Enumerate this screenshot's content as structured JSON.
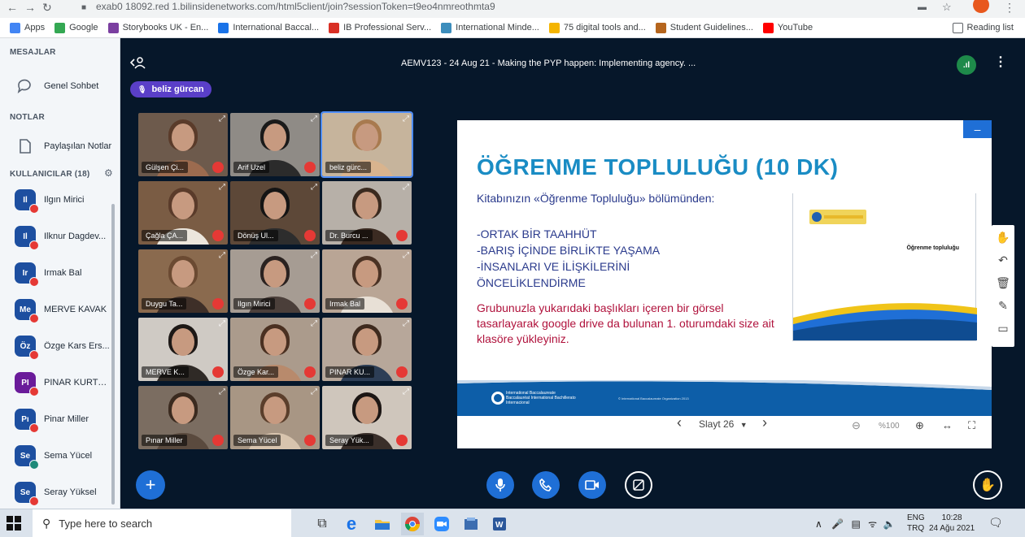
{
  "browser": {
    "url": "exab0 18092.red 1.bilinsidenetworks.com/html5client/join?sessionToken=t9eo4nmreothmta9",
    "bookmarks": [
      {
        "label": "Apps",
        "icon": "apps-icon",
        "color": "#4285f4"
      },
      {
        "label": "Google",
        "icon": "google-icon",
        "color": "#34a853"
      },
      {
        "label": "Storybooks UK - En...",
        "icon": "storybooks-icon",
        "color": "#7b3fa0"
      },
      {
        "label": "International Baccal...",
        "icon": "ib-icon",
        "color": "#1a73e8"
      },
      {
        "label": "IB Professional Serv...",
        "icon": "ib-pro-icon",
        "color": "#d93025"
      },
      {
        "label": "International Minde...",
        "icon": "minde-icon",
        "color": "#3c8dbc"
      },
      {
        "label": "75 digital tools and...",
        "icon": "tools-icon",
        "color": "#f4b400"
      },
      {
        "label": "Student Guidelines...",
        "icon": "guidelines-icon",
        "color": "#b5651d"
      },
      {
        "label": "YouTube",
        "icon": "youtube-icon",
        "color": "#ff0000"
      }
    ],
    "reading_list": "Reading list"
  },
  "sidebar": {
    "messages_title": "MESAJLAR",
    "public_chat": "Genel Sohbet",
    "notes_title": "NOTLAR",
    "shared_notes": "Paylaşılan Notlar",
    "users_title": "KULLANICILAR (18)",
    "users": [
      {
        "initials": "Il",
        "name": "Ilgın Mirici",
        "style": "blue",
        "mic": "red"
      },
      {
        "initials": "Il",
        "name": "Ilknur Dagdev...",
        "style": "blue",
        "mic": "red"
      },
      {
        "initials": "Ir",
        "name": "Irmak Bal",
        "style": "blue",
        "mic": "red"
      },
      {
        "initials": "Me",
        "name": "MERVE KAVAK",
        "style": "blue",
        "mic": "red"
      },
      {
        "initials": "Öz",
        "name": "Özge Kars Ers...",
        "style": "blue",
        "mic": "red"
      },
      {
        "initials": "PI",
        "name": "PINAR KURTO...",
        "style": "pink",
        "mic": "red"
      },
      {
        "initials": "Pı",
        "name": "Pinar Miller",
        "style": "blue",
        "mic": "red"
      },
      {
        "initials": "Se",
        "name": "Sema Yücel",
        "style": "blue",
        "mic": "green"
      },
      {
        "initials": "Se",
        "name": "Seray Yüksel",
        "style": "blue",
        "mic": "red"
      }
    ]
  },
  "header": {
    "back_icon": "back-users-icon",
    "title": "AEMV123 - 24 Aug 21 - Making the PYP happen: Implementing agency. ...",
    "connection": ".ıl",
    "talking": "beliz gürcan"
  },
  "videos": [
    {
      "name": "Gülşen Çi...",
      "shirt": "#9c6b4f",
      "hair": "#5a3b2a",
      "bg": "#6d5a4c",
      "active": false
    },
    {
      "name": "Arif Uzel",
      "shirt": "#2b2b2b",
      "hair": "#1a1a1a",
      "bg": "#8f8b86",
      "active": false
    },
    {
      "name": "beliz gürc...",
      "shirt": "#d9b48e",
      "hair": "#a87a4f",
      "bg": "#c6b49c",
      "active": true
    },
    {
      "name": "Çağla ÇA...",
      "shirt": "#ece6dc",
      "hair": "#5a3b2a",
      "bg": "#7a5c44",
      "active": false
    },
    {
      "name": "Dönüş Ul...",
      "shirt": "#2d2d2d",
      "hair": "#141414",
      "bg": "#5d4838",
      "active": false
    },
    {
      "name": "Dr. Burcu ...",
      "shirt": "#3b2b22",
      "hair": "#3a2a1f",
      "bg": "#b7b0a8",
      "active": false
    },
    {
      "name": "Duygu Ta...",
      "shirt": "#3e2f28",
      "hair": "#6b4a32",
      "bg": "#8a6a4e",
      "active": false
    },
    {
      "name": "Ilgın Mirici",
      "shirt": "#4b3f3a",
      "hair": "#2a2220",
      "bg": "#a69c93",
      "active": false
    },
    {
      "name": "Irmak Bal",
      "shirt": "#e8e0d6",
      "hair": "#4a3224",
      "bg": "#b9a595",
      "active": false
    },
    {
      "name": "MERVE K...",
      "shirt": "#2f2a26",
      "hair": "#1d1816",
      "bg": "#cfcac4",
      "active": false
    },
    {
      "name": "Özge Kar...",
      "shirt": "#b88a6c",
      "hair": "#4a3021",
      "bg": "#ab9b8c",
      "active": false
    },
    {
      "name": "PINAR KU...",
      "shirt": "#2d3e56",
      "hair": "#3e2a1e",
      "bg": "#b7a79a",
      "active": false
    },
    {
      "name": "Pınar Miller",
      "shirt": "#5a4a3e",
      "hair": "#3a2a1f",
      "bg": "#7b6d61",
      "active": false
    },
    {
      "name": "Sema Yücel",
      "shirt": "#d8c4ae",
      "hair": "#5b3e2b",
      "bg": "#a89684",
      "active": false
    },
    {
      "name": "Seray Yük...",
      "shirt": "#3a2f2a",
      "hair": "#1c1614",
      "bg": "#cfc6bc",
      "active": false
    }
  ],
  "slide": {
    "title": "ÖĞRENME TOPLULUĞU (10 DK)",
    "intro": "Kitabınızın «Öğrenme Topluluğu» bölümünden:",
    "points": [
      "-ORTAK BİR TAAHHÜT",
      "-BARIŞ İÇİNDE BİRLİKTE YAŞAMA",
      "-İNSANLARI VE İLİŞKİLERİNİ",
      "ÖNCELİKLENDİRME"
    ],
    "task": "Grubunuzla yukarıdaki başlıkları içeren bir görsel tasarlayarak google drive da bulunan 1. oturumdaki size ait klasöre yükleyiniz.",
    "thumb_title": "Öğrenme topluluğu",
    "footer_logo": "International Baccalaureate Baccalauréat International Bachillerato Internacional",
    "footer_copy": "© International Baccalaureate Organization 2013",
    "minimize": "–",
    "colors": {
      "title": "#1a8cc4",
      "body": "#2a3a8c",
      "task": "#b0123c",
      "footer": "#0d5ea8"
    }
  },
  "slide_controls": {
    "prev": "‹",
    "slide_label": "Slayt 26",
    "next": "›",
    "zoom_out": "⊖",
    "zoom": "%100",
    "zoom_in": "⊕",
    "fit_width": "↔",
    "fullscreen": "⛶"
  },
  "annotation_tools": [
    "hand-tool-icon",
    "undo-icon",
    "trash-icon",
    "pen-icon",
    "whiteboard-icon"
  ],
  "bottom": {
    "actions_icon": "plus-icon",
    "mic_icon": "microphone-icon",
    "phone_icon": "phone-icon",
    "camera_icon": "camera-icon",
    "share_icon": "screen-share-icon",
    "raise_icon": "raise-hand-icon"
  },
  "taskbar": {
    "search_placeholder": "Type here to search",
    "lang_top": "ENG",
    "lang_bottom": "TRQ",
    "time": "10:28",
    "date": "24 Ağu 2021"
  }
}
